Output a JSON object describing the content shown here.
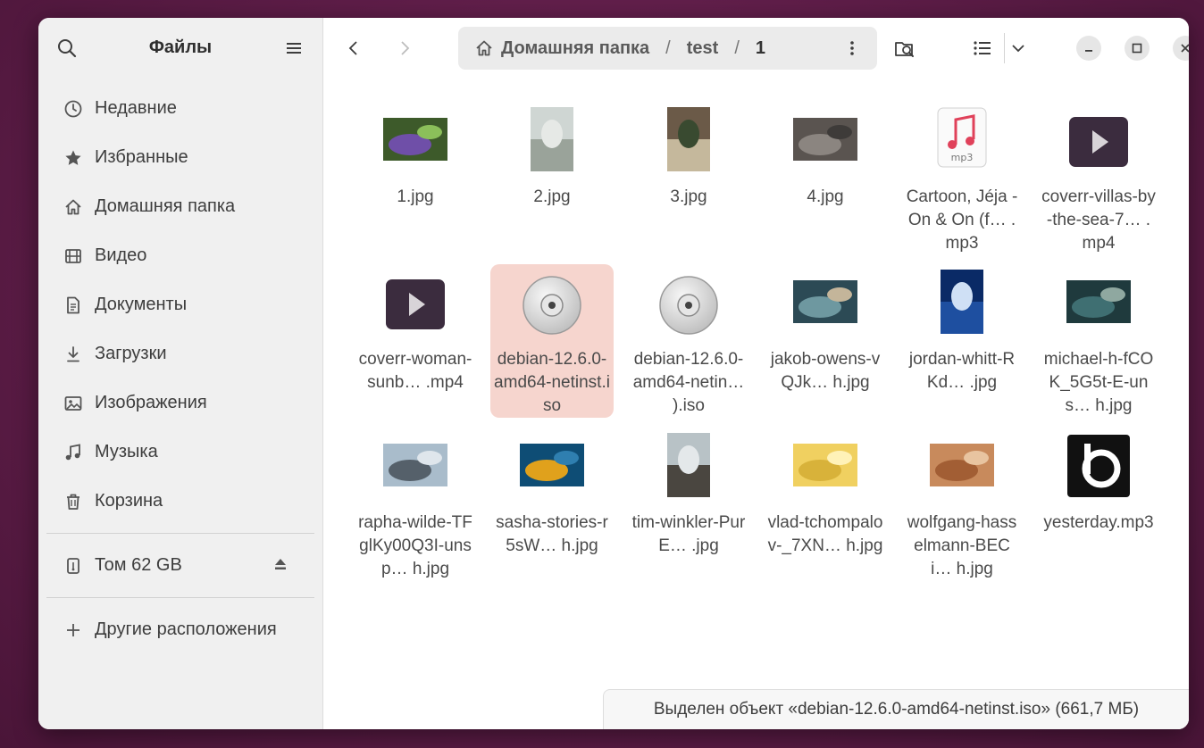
{
  "sidebar": {
    "title": "Файлы",
    "places": [
      {
        "label": "Недавние",
        "icon": "clock-icon"
      },
      {
        "label": "Избранные",
        "icon": "star-icon"
      },
      {
        "label": "Домашняя папка",
        "icon": "home-icon"
      },
      {
        "label": "Видео",
        "icon": "film-icon"
      },
      {
        "label": "Документы",
        "icon": "document-icon"
      },
      {
        "label": "Загрузки",
        "icon": "download-icon"
      },
      {
        "label": "Изображения",
        "icon": "image-icon"
      },
      {
        "label": "Музыка",
        "icon": "music-icon"
      },
      {
        "label": "Корзина",
        "icon": "trash-icon"
      }
    ],
    "volume": {
      "label": "Том 62 GB",
      "icon": "usb-drive-icon"
    },
    "other": {
      "label": "Другие расположения",
      "icon": "plus-icon"
    }
  },
  "pathbar": {
    "crumbs": [
      "Домашняя папка",
      "test",
      "1"
    ]
  },
  "files": [
    {
      "name": "1.jpg",
      "kind": "image",
      "palette": [
        "#3d5a2a",
        "#6f4fa8",
        "#8bbf5a"
      ]
    },
    {
      "name": "2.jpg",
      "kind": "image-portrait",
      "palette": [
        "#cfd6d3",
        "#9aa39a",
        "#e6e9e6"
      ]
    },
    {
      "name": "3.jpg",
      "kind": "image-portrait",
      "palette": [
        "#6b5a48",
        "#c5b89c",
        "#394a30"
      ]
    },
    {
      "name": "4.jpg",
      "kind": "image",
      "palette": [
        "#5a5450",
        "#8b8580",
        "#3e3b39"
      ]
    },
    {
      "name": "Cartoon, Jéja - On & On (f… .mp3",
      "kind": "audio",
      "badge": "mp3"
    },
    {
      "name": "coverr-villas-by-the-sea-7… .mp4",
      "kind": "video"
    },
    {
      "name": "coverr-woman-sunb… .mp4",
      "kind": "video"
    },
    {
      "name": "debian-12.6.0-amd64-netinst.iso",
      "kind": "disc",
      "selected": true
    },
    {
      "name": "debian-12.6.0-amd64-netin… ).iso",
      "kind": "disc"
    },
    {
      "name": "jakob-owens-vQJk… h.jpg",
      "kind": "image",
      "palette": [
        "#2c4a55",
        "#6e98a0",
        "#c4b59a"
      ]
    },
    {
      "name": "jordan-whitt-RKd… .jpg",
      "kind": "image-portrait",
      "palette": [
        "#0a2a66",
        "#1e4fa0",
        "#cfe0f5"
      ]
    },
    {
      "name": "michael-h-fCOK_5G5t-E-uns… h.jpg",
      "kind": "image",
      "palette": [
        "#1f3a3d",
        "#3f6f72",
        "#8fa8a0"
      ]
    },
    {
      "name": "rapha-wilde-TFglKy00Q3I-unsp… h.jpg",
      "kind": "image",
      "palette": [
        "#a9bccb",
        "#55606a",
        "#dfe6ec"
      ]
    },
    {
      "name": "sasha-stories-r5sW… h.jpg",
      "kind": "image",
      "palette": [
        "#0e4d75",
        "#e0a11c",
        "#2f7fb0"
      ]
    },
    {
      "name": "tim-winkler-PurE… .jpg",
      "kind": "image-portrait",
      "palette": [
        "#b8c2c6",
        "#4a4640",
        "#e4e8ea"
      ]
    },
    {
      "name": "vlad-tchompalov-_7XN… h.jpg",
      "kind": "image",
      "palette": [
        "#f0d060",
        "#d8b23a",
        "#fff2b8"
      ]
    },
    {
      "name": "wolfgang-hasselmann-BECi… h.jpg",
      "kind": "image",
      "palette": [
        "#c88a5c",
        "#a25e34",
        "#e8c4a0"
      ]
    },
    {
      "name": "yesterday.mp3",
      "kind": "logo"
    }
  ],
  "status": "Выделен объект «debian-12.6.0-amd64-netinst.iso» (661,7 МБ)",
  "colors": {
    "selection": "#f6d5ce",
    "sidebar_bg": "#f0f0f0",
    "desktop": "#5e1d48"
  }
}
